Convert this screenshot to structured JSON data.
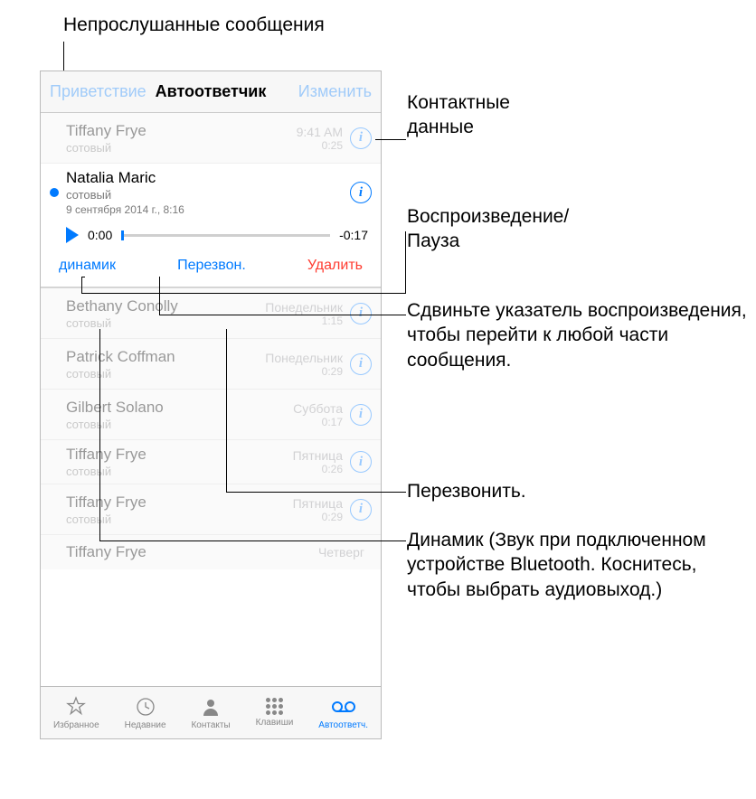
{
  "top_label": "Непрослушанные сообщения",
  "nav": {
    "left": "Приветствие",
    "title": "Автоответчик",
    "right": "Изменить"
  },
  "rows": [
    {
      "name": "Tiffany Frye",
      "sub": "сотовый",
      "time": "9:41 AM",
      "dur": "0:25"
    },
    {
      "name": "Natalia Maric",
      "sub": "сотовый",
      "date": "9 сентября 2014 г., 8:16"
    },
    {
      "name": "Bethany Conolly",
      "sub": "сотовый",
      "time": "Понедельник",
      "dur": "1:15"
    },
    {
      "name": "Patrick Coffman",
      "sub": "сотовый",
      "time": "Понедельник",
      "dur": "0:29"
    },
    {
      "name": "Gilbert Solano",
      "sub": "сотовый",
      "time": "Суббота",
      "dur": "0:17"
    },
    {
      "name": "Tiffany Frye",
      "sub": "сотовый",
      "time": "Пятница",
      "dur": "0:26"
    },
    {
      "name": "Tiffany Frye",
      "sub": "сотовый",
      "time": "Пятница",
      "dur": "0:29"
    },
    {
      "name": "Tiffany Frye",
      "sub": "сотовый",
      "time": "Четверг",
      "dur": ""
    }
  ],
  "player": {
    "elapsed": "0:00",
    "remaining": "-0:17"
  },
  "actions": {
    "speaker": "динамик",
    "callback": "Перезвон.",
    "delete": "Удалить"
  },
  "tabs": [
    "Избранное",
    "Недавние",
    "Контакты",
    "Клавиши",
    "Автоответч."
  ],
  "annotations": {
    "contact": "Контактные\nданные",
    "play": "Воспроизведение/\nПауза",
    "scrub": "Сдвиньте указатель воспроизведения, чтобы перейти к любой части сообщения.",
    "callback": "Перезвонить.",
    "speaker": "Динамик (Звук при подключенном устройстве Bluetooth. Коснитесь, чтобы выбрать аудиовыход.)"
  }
}
